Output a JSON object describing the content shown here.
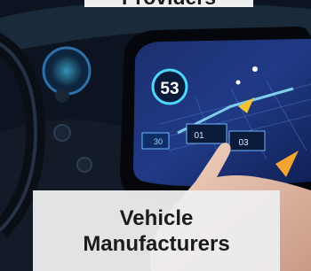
{
  "top_banner": {
    "text": "Providers"
  },
  "caption": {
    "line1": "Vehicle",
    "line2": "Manufacturers"
  },
  "screen": {
    "speed": "53",
    "tile_a": "01",
    "tile_b": "03",
    "tile_c": "30"
  }
}
